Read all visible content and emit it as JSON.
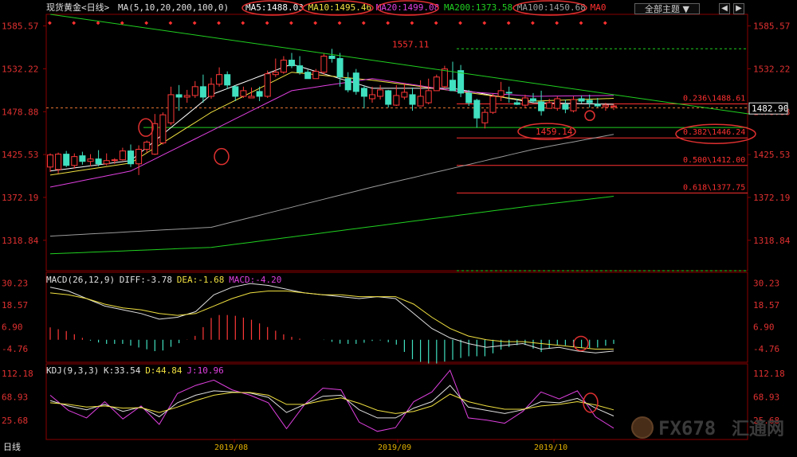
{
  "toolbar": {
    "instrument": "现货黄金<日线>",
    "ma_params": "MA(5,10,20,200,100,0)",
    "ma_values": [
      {
        "text": "MA5:1488.03",
        "color": "#ffffff"
      },
      {
        "text": "MA10:1495.46",
        "color": "#f0e040"
      },
      {
        "text": "MA20:1499.08",
        "color": "#e040e0"
      },
      {
        "text": "MA200:1373.58",
        "color": "#20d020"
      },
      {
        "text": "MA100:1450.68",
        "color": "#a0a0a0"
      },
      {
        "text": "MA0",
        "color": "#ff3030"
      }
    ],
    "theme_label": "全部主题",
    "theme_arrow": "▼",
    "win_buttons": [
      "◀",
      "▶"
    ]
  },
  "period_tab": "日线",
  "watermark": {
    "text1": "FX678",
    "text2": "汇通网"
  },
  "colors": {
    "up": "#ff3838",
    "down": "#40e0c0",
    "ma5": "#ffffff",
    "ma10": "#f0e040",
    "ma20": "#e040e0",
    "ma100": "#9a9a9a",
    "ma200": "#20d020",
    "grid": "#8b0000",
    "trend": "#20d020",
    "fib": "#ff3030",
    "annot": "#e03030",
    "axis_text": "#e03030"
  },
  "chart_data": [
    {
      "type": "line",
      "title": "现货黄金<日线>",
      "series_candles": {
        "name": "Daily candles",
        "x": [
          "2019-07-17",
          "2019-07-18",
          "2019-07-19",
          "2019-07-22",
          "2019-07-23",
          "2019-07-24",
          "2019-07-25",
          "2019-07-26",
          "2019-07-29",
          "2019-07-30",
          "2019-07-31",
          "2019-08-01",
          "2019-08-02",
          "2019-08-05",
          "2019-08-06",
          "2019-08-07",
          "2019-08-08",
          "2019-08-09",
          "2019-08-12",
          "2019-08-13",
          "2019-08-14",
          "2019-08-15",
          "2019-08-16",
          "2019-08-19",
          "2019-08-20",
          "2019-08-21",
          "2019-08-22",
          "2019-08-23",
          "2019-08-26",
          "2019-08-27",
          "2019-08-28",
          "2019-08-29",
          "2019-08-30",
          "2019-09-02",
          "2019-09-03",
          "2019-09-04",
          "2019-09-05",
          "2019-09-06",
          "2019-09-09",
          "2019-09-10",
          "2019-09-11",
          "2019-09-12",
          "2019-09-13",
          "2019-09-16",
          "2019-09-17",
          "2019-09-18",
          "2019-09-19",
          "2019-09-20",
          "2019-09-23",
          "2019-09-24",
          "2019-09-25",
          "2019-09-26",
          "2019-09-27",
          "2019-09-30",
          "2019-10-01",
          "2019-10-02",
          "2019-10-03",
          "2019-10-04",
          "2019-10-07",
          "2019-10-08",
          "2019-10-09",
          "2019-10-10",
          "2019-10-11",
          "2019-10-14",
          "2019-10-15",
          "2019-10-16",
          "2019-10-17",
          "2019-10-18",
          "2019-10-21",
          "2019-10-22",
          "2019-10-23"
        ],
        "open": [
          1410,
          1407,
          1426,
          1412,
          1424,
          1417,
          1420,
          1414,
          1418,
          1419,
          1430,
          1414,
          1432,
          1426,
          1440,
          1465,
          1500,
          1497,
          1499,
          1510,
          1498,
          1513,
          1525,
          1510,
          1498,
          1496,
          1504,
          1498,
          1525,
          1528,
          1543,
          1536,
          1528,
          1520,
          1528,
          1548,
          1545,
          1520,
          1527,
          1508,
          1495,
          1498,
          1505,
          1487,
          1497,
          1500,
          1486,
          1490,
          1505,
          1510,
          1518,
          1530,
          1502,
          1493,
          1465,
          1478,
          1498,
          1503,
          1490,
          1487,
          1495,
          1491,
          1483,
          1483,
          1488,
          1480,
          1495,
          1493,
          1488,
          1485,
          1486
        ],
        "high": [
          1427,
          1428,
          1430,
          1427,
          1429,
          1426,
          1431,
          1427,
          1421,
          1434,
          1438,
          1437,
          1443,
          1476,
          1478,
          1510,
          1512,
          1506,
          1517,
          1525,
          1521,
          1534,
          1529,
          1512,
          1510,
          1509,
          1510,
          1530,
          1545,
          1548,
          1552,
          1548,
          1531,
          1532,
          1551,
          1557,
          1552,
          1528,
          1532,
          1511,
          1510,
          1512,
          1506,
          1512,
          1514,
          1509,
          1518,
          1520,
          1525,
          1536,
          1541,
          1537,
          1506,
          1495,
          1482,
          1501,
          1516,
          1510,
          1495,
          1500,
          1502,
          1505,
          1495,
          1498,
          1494,
          1498,
          1499,
          1500,
          1496,
          1490,
          1488
        ],
        "low": [
          1404,
          1402,
          1410,
          1408,
          1413,
          1411,
          1411,
          1412,
          1414,
          1418,
          1410,
          1400,
          1428,
          1425,
          1438,
          1462,
          1480,
          1490,
          1496,
          1490,
          1495,
          1510,
          1507,
          1492,
          1496,
          1496,
          1492,
          1496,
          1522,
          1526,
          1533,
          1525,
          1521,
          1520,
          1525,
          1540,
          1510,
          1503,
          1500,
          1483,
          1490,
          1494,
          1484,
          1486,
          1494,
          1480,
          1486,
          1488,
          1505,
          1508,
          1515,
          1497,
          1486,
          1459,
          1458,
          1476,
          1492,
          1490,
          1487,
          1484,
          1490,
          1474,
          1483,
          1480,
          1477,
          1478,
          1489,
          1484,
          1484,
          1480,
          1481
        ],
        "close": [
          1425,
          1426,
          1412,
          1423,
          1417,
          1420,
          1414,
          1418,
          1419,
          1430,
          1414,
          1432,
          1441,
          1464,
          1475,
          1500,
          1497,
          1499,
          1510,
          1497,
          1513,
          1525,
          1512,
          1498,
          1505,
          1498,
          1498,
          1526,
          1528,
          1543,
          1536,
          1528,
          1520,
          1529,
          1548,
          1545,
          1522,
          1506,
          1504,
          1498,
          1500,
          1506,
          1488,
          1499,
          1503,
          1488,
          1498,
          1505,
          1522,
          1532,
          1505,
          1502,
          1490,
          1471,
          1478,
          1498,
          1505,
          1502,
          1488,
          1496,
          1492,
          1480,
          1490,
          1495,
          1482,
          1494,
          1492,
          1490,
          1486,
          1487,
          1486
        ]
      },
      "series_ma": [
        {
          "name": "MA5",
          "x_index": [
            0,
            10,
            20,
            30,
            40,
            50,
            60,
            70
          ],
          "values": [
            1405,
            1418,
            1500,
            1538,
            1508,
            1508,
            1490,
            1488.03
          ]
        },
        {
          "name": "MA10",
          "x_index": [
            0,
            10,
            20,
            30,
            40,
            50,
            60,
            70
          ],
          "values": [
            1400,
            1415,
            1478,
            1528,
            1518,
            1505,
            1492,
            1495.46
          ]
        },
        {
          "name": "MA20",
          "x_index": [
            0,
            10,
            20,
            30,
            40,
            50,
            60,
            70
          ],
          "values": [
            1385,
            1405,
            1455,
            1505,
            1520,
            1505,
            1498,
            1499.08
          ]
        },
        {
          "name": "MA100",
          "x_index": [
            0,
            20,
            40,
            60,
            70
          ],
          "values": [
            1324,
            1335,
            1385,
            1432,
            1450.68
          ]
        },
        {
          "name": "MA200",
          "x_index": [
            0,
            20,
            40,
            60,
            70
          ],
          "values": [
            1302,
            1310,
            1336,
            1362,
            1373.58
          ]
        }
      ],
      "peak_label": "1557.11",
      "low_label": "1459.14",
      "price_tag": "1482.90",
      "fib_levels": [
        {
          "label": "0.236\\1488.61",
          "value": 1488.61
        },
        {
          "label": "0.382\\1446.24",
          "value": 1446.24
        },
        {
          "label": "0.500\\1412.00",
          "value": 1412.0
        },
        {
          "label": "0.618\\1377.75",
          "value": 1377.75
        }
      ],
      "y_ticks": [
        1585.57,
        1532.22,
        1478.88,
        1425.53,
        1372.19,
        1318.84
      ],
      "y_tick_labels": [
        "1585.57",
        "1532.22",
        "1478.88",
        "1425.53",
        "1372.19",
        "1318.84"
      ],
      "ylim": [
        1281,
        1600
      ]
    },
    {
      "type": "bar",
      "title": "MACD(26,12,9)",
      "legend": [
        {
          "text": "MACD(26,12,9)",
          "color": "#e0e0e0"
        },
        {
          "text": "DIFF:-3.78",
          "color": "#e0e0e0"
        },
        {
          "text": "DEA:-1.68",
          "color": "#f0e040"
        },
        {
          "text": "MACD:-4.20",
          "color": "#e040e0"
        }
      ],
      "diff": [
        28,
        26,
        22,
        18,
        16,
        14,
        11,
        12,
        15,
        24,
        28,
        30,
        29,
        27,
        25,
        24,
        23,
        22,
        23,
        22,
        14,
        6,
        1,
        -2,
        -4,
        -3,
        -2,
        -5,
        -4,
        -6,
        -7,
        -6
      ],
      "dea": [
        25,
        24,
        22,
        19,
        17,
        16,
        14,
        13,
        14,
        18,
        22,
        25,
        26,
        26,
        25,
        24,
        24,
        23,
        23,
        23,
        19,
        12,
        6,
        2,
        0,
        -1,
        -1,
        -2,
        -3,
        -4,
        -5,
        -5
      ],
      "y_ticks": [
        30.23,
        18.57,
        6.9,
        -4.76
      ],
      "y_tick_labels": [
        "30.23",
        "18.57",
        "6.90",
        "-4.76"
      ],
      "ylim": [
        -12,
        36
      ]
    },
    {
      "type": "line",
      "title": "KDJ(9,3,3)",
      "legend": [
        {
          "text": "KDJ(9,3,3)",
          "color": "#e0e0e0"
        },
        {
          "text": "K:33.54",
          "color": "#e0e0e0"
        },
        {
          "text": "D:44.84",
          "color": "#f0e040"
        },
        {
          "text": "J:10.96",
          "color": "#e040e0"
        }
      ],
      "k": [
        62,
        52,
        45,
        55,
        42,
        50,
        32,
        58,
        72,
        80,
        78,
        76,
        68,
        40,
        55,
        70,
        72,
        45,
        30,
        30,
        48,
        60,
        90,
        50,
        44,
        38,
        45,
        60,
        58,
        66,
        48,
        33.54
      ],
      "d": [
        58,
        55,
        50,
        52,
        48,
        49,
        40,
        50,
        62,
        72,
        77,
        77,
        72,
        55,
        55,
        62,
        67,
        57,
        44,
        38,
        42,
        52,
        74,
        60,
        52,
        46,
        46,
        52,
        55,
        60,
        54,
        44.84
      ],
      "j": [
        72,
        44,
        30,
        60,
        28,
        52,
        18,
        75,
        90,
        100,
        82,
        72,
        58,
        10,
        55,
        85,
        82,
        22,
        5,
        12,
        60,
        78,
        118,
        30,
        26,
        20,
        42,
        78,
        65,
        80,
        32,
        10.96
      ],
      "y_ticks": [
        112.18,
        68.93,
        25.68
      ],
      "y_tick_labels": [
        "112.18",
        "68.93",
        "25.68"
      ],
      "ylim": [
        -10,
        130
      ]
    }
  ],
  "x_axis": {
    "labels": [
      "2019/08",
      "2019/09",
      "2019/10"
    ]
  }
}
